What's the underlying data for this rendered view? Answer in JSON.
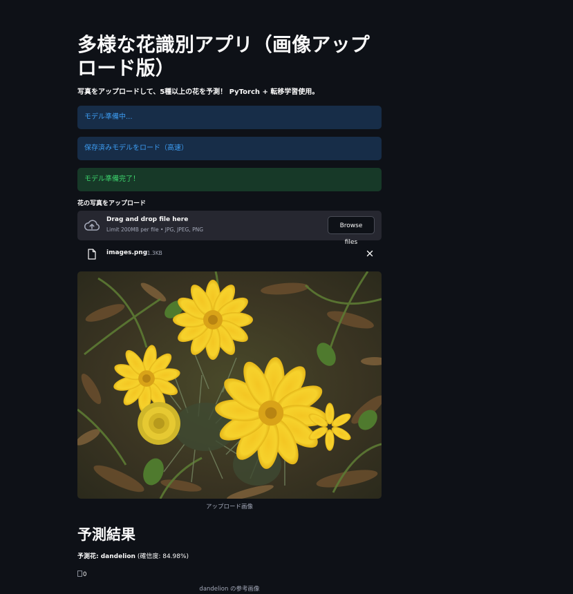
{
  "header": {
    "title": "多様な花識別アプリ（画像アップロード版）",
    "subtitle": "写真をアップロードして、5種以上の花を予測！ PyTorch + 転移学習使用。"
  },
  "alerts": {
    "preparing": "モデル準備中...",
    "loading": "保存済みモデルをロード（高速）",
    "ready": "モデル準備完了！"
  },
  "uploader": {
    "label": "花の写真をアップロード",
    "drop_title": "Drag and drop file here",
    "drop_limit": "Limit 200MB per file • JPG, JPEG, PNG",
    "browse_label": "Browse files",
    "file_name": "images.png",
    "file_size": "11.3KB"
  },
  "uploaded_image": {
    "caption": "アップロード画像"
  },
  "result": {
    "heading": "予測結果",
    "prefix": "予測花: ",
    "flower": "dandelion",
    "confidence_text": " (確信度: 84.98%)",
    "confidence": 84.98,
    "reference_alt": "0",
    "reference_caption": "dandelion の参考画像"
  },
  "colors": {
    "background": "#0e1117",
    "info_bg": "#172d48",
    "info_text": "#3d9df3",
    "success_bg": "#173928",
    "success_text": "#3dd56d",
    "dropzone_bg": "#262730"
  },
  "icons": [
    "cloud-upload-icon",
    "file-icon",
    "close-icon",
    "broken-image-icon"
  ]
}
